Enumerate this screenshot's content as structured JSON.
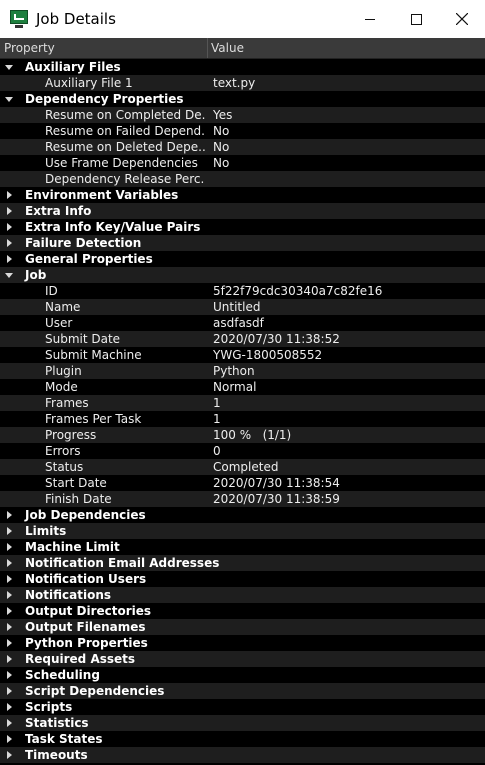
{
  "window": {
    "title": "Job Details"
  },
  "header": {
    "property": "Property",
    "value": "Value"
  },
  "rows": [
    {
      "type": "group",
      "label": "Auxiliary Files",
      "expanded": true
    },
    {
      "type": "item",
      "label": "Auxiliary File 1",
      "value": "text.py"
    },
    {
      "type": "group",
      "label": "Dependency Properties",
      "expanded": true
    },
    {
      "type": "item",
      "label": "Resume on Completed De...",
      "value": "Yes"
    },
    {
      "type": "item",
      "label": "Resume on Failed Depend...",
      "value": "No"
    },
    {
      "type": "item",
      "label": "Resume on Deleted Depe...",
      "value": "No"
    },
    {
      "type": "item",
      "label": "Use Frame Dependencies",
      "value": "No"
    },
    {
      "type": "item",
      "label": "Dependency Release Perc...",
      "value": ""
    },
    {
      "type": "group",
      "label": "Environment Variables",
      "expanded": false
    },
    {
      "type": "group",
      "label": "Extra Info",
      "expanded": false
    },
    {
      "type": "group",
      "label": "Extra Info Key/Value Pairs",
      "expanded": false
    },
    {
      "type": "group",
      "label": "Failure Detection",
      "expanded": false
    },
    {
      "type": "group",
      "label": "General Properties",
      "expanded": false
    },
    {
      "type": "group",
      "label": "Job",
      "expanded": true
    },
    {
      "type": "item",
      "label": "ID",
      "value": "5f22f79cdc30340a7c82fe16"
    },
    {
      "type": "item",
      "label": "Name",
      "value": "Untitled"
    },
    {
      "type": "item",
      "label": "User",
      "value": "asdfasdf"
    },
    {
      "type": "item",
      "label": "Submit Date",
      "value": "2020/07/30 11:38:52"
    },
    {
      "type": "item",
      "label": "Submit Machine",
      "value": "YWG-1800508552"
    },
    {
      "type": "item",
      "label": "Plugin",
      "value": "Python"
    },
    {
      "type": "item",
      "label": "Mode",
      "value": "Normal"
    },
    {
      "type": "item",
      "label": "Frames",
      "value": "1"
    },
    {
      "type": "item",
      "label": "Frames Per Task",
      "value": "1"
    },
    {
      "type": "item",
      "label": "Progress",
      "value": "100 %   (1/1)"
    },
    {
      "type": "item",
      "label": "Errors",
      "value": "0"
    },
    {
      "type": "item",
      "label": "Status",
      "value": "Completed"
    },
    {
      "type": "item",
      "label": "Start Date",
      "value": "2020/07/30 11:38:54"
    },
    {
      "type": "item",
      "label": "Finish Date",
      "value": "2020/07/30 11:38:59"
    },
    {
      "type": "group",
      "label": "Job Dependencies",
      "expanded": false
    },
    {
      "type": "group",
      "label": "Limits",
      "expanded": false
    },
    {
      "type": "group",
      "label": "Machine Limit",
      "expanded": false
    },
    {
      "type": "group",
      "label": "Notification Email Addresses",
      "expanded": false
    },
    {
      "type": "group",
      "label": "Notification Users",
      "expanded": false
    },
    {
      "type": "group",
      "label": "Notifications",
      "expanded": false
    },
    {
      "type": "group",
      "label": "Output Directories",
      "expanded": false
    },
    {
      "type": "group",
      "label": "Output Filenames",
      "expanded": false
    },
    {
      "type": "group",
      "label": "Python Properties",
      "expanded": false
    },
    {
      "type": "group",
      "label": "Required Assets",
      "expanded": false
    },
    {
      "type": "group",
      "label": "Scheduling",
      "expanded": false
    },
    {
      "type": "group",
      "label": "Script Dependencies",
      "expanded": false
    },
    {
      "type": "group",
      "label": "Scripts",
      "expanded": false
    },
    {
      "type": "group",
      "label": "Statistics",
      "expanded": false
    },
    {
      "type": "group",
      "label": "Task States",
      "expanded": false
    },
    {
      "type": "group",
      "label": "Timeouts",
      "expanded": false
    }
  ]
}
